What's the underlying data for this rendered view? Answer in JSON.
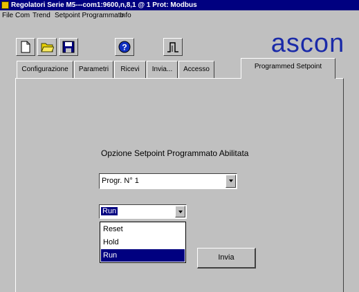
{
  "window": {
    "title": "Regolatori Serie M5---com1:9600,n,8,1 @ 1 Prot: Modbus"
  },
  "menu": [
    "File",
    "Com",
    "Trend",
    "Setpoint Programmato",
    "Info"
  ],
  "toolbar": {
    "icons": [
      "new-document-icon",
      "open-folder-icon",
      "save-disk-icon",
      "help-icon",
      "signal-pulse-icon"
    ]
  },
  "logo": {
    "text": "ascon",
    "color": "#1a2aa8"
  },
  "tabs": [
    {
      "label": "Configurazione"
    },
    {
      "label": "Parametri"
    },
    {
      "label": "Ricevi"
    },
    {
      "label": "Invia..."
    },
    {
      "label": "Accesso"
    },
    {
      "label": "Programmed Setpoint"
    }
  ],
  "active_tab": "Programmed Setpoint",
  "main": {
    "option_label": "Opzione Setpoint Programmato Abilitata",
    "program_select": {
      "value": "Progr. N° 1"
    },
    "mode_select": {
      "value": "Run",
      "options": [
        "Reset",
        "Hold",
        "Run"
      ],
      "highlighted": "Run"
    },
    "send_button": "Invia"
  },
  "colors": {
    "titlebar": "#000080",
    "face": "#c0c0c0",
    "selection": "#000080"
  }
}
